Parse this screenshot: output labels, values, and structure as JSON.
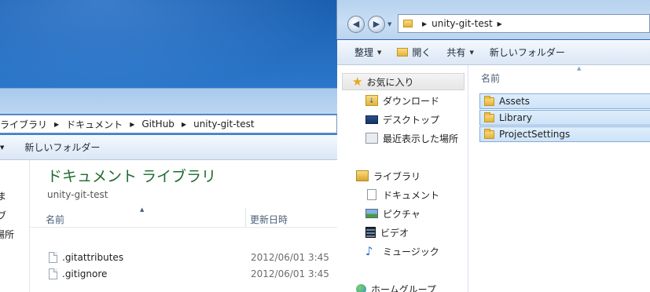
{
  "back_window": {
    "breadcrumb": [
      "ライブラリ",
      "ドキュメント",
      "GitHub",
      "unity-git-test"
    ],
    "toolbar": {
      "new_folder": "新しいフォルダー"
    },
    "nav_fragments": [
      "ま",
      "ブ",
      "場所"
    ],
    "library_title": "ドキュメント ライブラリ",
    "library_subtitle": "unity-git-test",
    "columns": {
      "name": "名前",
      "modified": "更新日時"
    },
    "files": [
      {
        "name": ".gitattributes",
        "modified": "2012/06/01 3:45"
      },
      {
        "name": ".gitignore",
        "modified": "2012/06/01 3:45"
      }
    ]
  },
  "front_window": {
    "breadcrumb": [
      "unity-git-test"
    ],
    "toolbar": {
      "organize": "整理",
      "open": "開く",
      "share": "共有",
      "new_folder": "新しいフォルダー"
    },
    "column_name": "名前",
    "nav": {
      "favorites": {
        "label": "お気に入り",
        "items": [
          "ダウンロード",
          "デスクトップ",
          "最近表示した場所"
        ]
      },
      "libraries": {
        "label": "ライブラリ",
        "items": [
          "ドキュメント",
          "ピクチャ",
          "ビデオ",
          "ミュージック"
        ]
      },
      "homegroup": {
        "label": "ホームグループ"
      }
    },
    "folders": [
      "Assets",
      "Library",
      "ProjectSettings"
    ]
  },
  "colors": {
    "desktop": "#2f7bd0",
    "library_title": "#1e6b2d",
    "selection": "#cde3f8"
  }
}
